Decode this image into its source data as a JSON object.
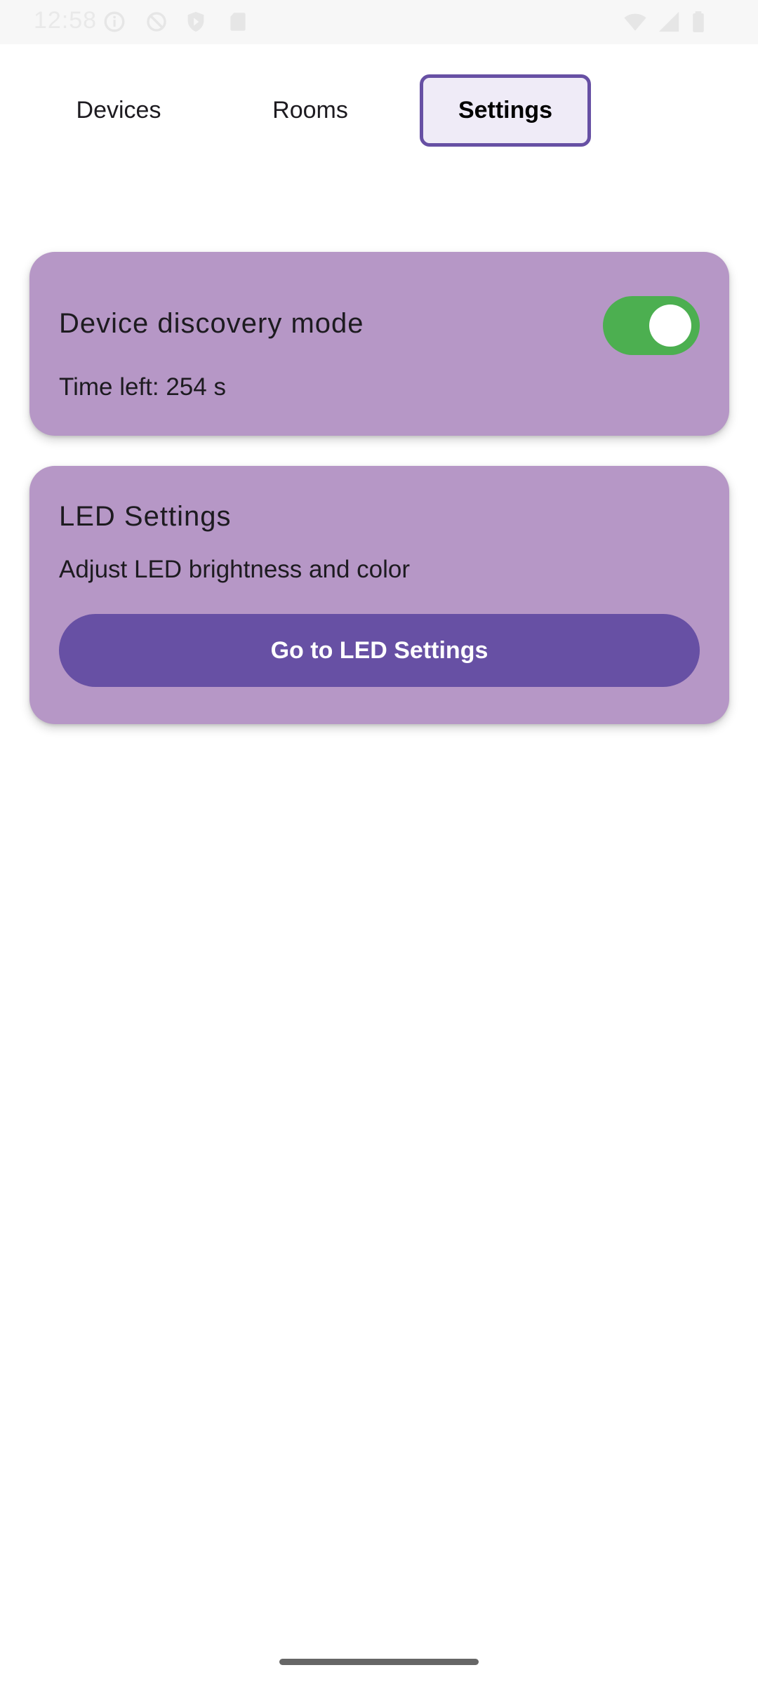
{
  "status_bar": {
    "time": "12:58",
    "left_icons": [
      "info-icon",
      "do-not-disturb-icon",
      "shield-icon",
      "sd-card-icon"
    ],
    "right_icons": [
      "wifi-icon",
      "cell-signal-icon",
      "battery-icon"
    ]
  },
  "tabs": [
    {
      "label": "Devices",
      "selected": false
    },
    {
      "label": "Rooms",
      "selected": false
    },
    {
      "label": "Settings",
      "selected": true
    }
  ],
  "discovery_card": {
    "title": "Device discovery mode",
    "timer": "Time left: 254 s",
    "toggle_on": true
  },
  "led_card": {
    "title": "LED Settings",
    "description": "Adjust LED brightness and color",
    "button_label": "Go to LED Settings"
  },
  "colors": {
    "accent": "#6750a4",
    "card_background": "#b697c6",
    "toggle_on": "#4caf50"
  }
}
